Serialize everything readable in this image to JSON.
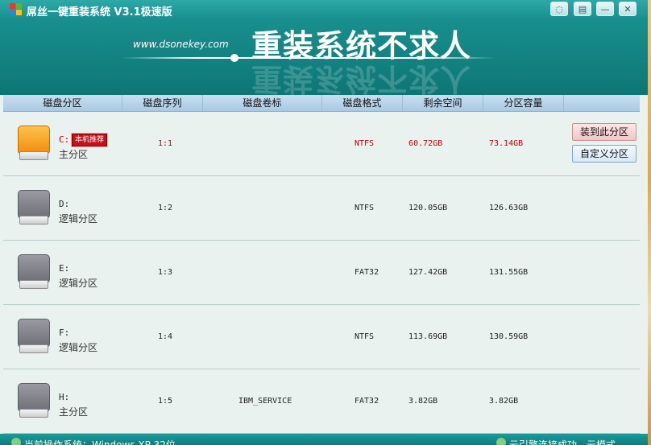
{
  "app": {
    "title": "屌丝一键重装系统 V3.1极速版",
    "logo_colors": [
      "#e8392a",
      "#4cb848",
      "#2e86d6",
      "#f7c21b"
    ],
    "window_buttons": [
      {
        "icon": "chat-icon",
        "glyph": "◌"
      },
      {
        "icon": "menu-icon",
        "glyph": "▤"
      },
      {
        "icon": "minimize-icon",
        "glyph": "—"
      },
      {
        "icon": "close-icon",
        "glyph": "✕"
      }
    ]
  },
  "banner": {
    "url": "www.dsonekey.com",
    "slogan": "重装系统不求人"
  },
  "columns": [
    "磁盘分区",
    "磁盘序列",
    "磁盘卷标",
    "磁盘格式",
    "剩余空间",
    "分区容量"
  ],
  "partitions": [
    {
      "letter": "C:",
      "type": "主分区",
      "seq": "1:1",
      "label": "",
      "format": "NTFS",
      "free": "60.72GB",
      "size": "73.14GB",
      "badge": "本机推荐",
      "active": true
    },
    {
      "letter": "D:",
      "type": "逻辑分区",
      "seq": "1:2",
      "label": "",
      "format": "NTFS",
      "free": "120.05GB",
      "size": "126.63GB"
    },
    {
      "letter": "E:",
      "type": "逻辑分区",
      "seq": "1:3",
      "label": "",
      "format": "FAT32",
      "free": "127.42GB",
      "size": "131.55GB"
    },
    {
      "letter": "F:",
      "type": "逻辑分区",
      "seq": "1:4",
      "label": "",
      "format": "NTFS",
      "free": "113.69GB",
      "size": "130.59GB"
    },
    {
      "letter": "H:",
      "type": "主分区",
      "seq": "1:5",
      "label": "IBM_SERVICE",
      "format": "FAT32",
      "free": "3.82GB",
      "size": "3.82GB"
    }
  ],
  "actions": {
    "install": "装到此分区",
    "custom": "自定义分区"
  },
  "status": {
    "left": "当前操作系统：Windows XP 32位",
    "right": "云引擎连接成功，云模式"
  },
  "colors": {
    "accent": "#168f8e",
    "active_text": "#c00000",
    "badge": "#c8101a"
  }
}
